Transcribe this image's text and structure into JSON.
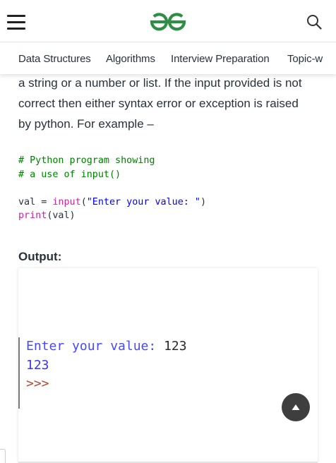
{
  "header": {
    "menu_icon": "hamburger-menu-icon",
    "logo_icon": "geeksforgeeks-logo",
    "search_icon": "search-icon",
    "brand_color": "#2f8d46"
  },
  "nav": {
    "items": [
      "Data Structures",
      "Algorithms",
      "Interview Preparation",
      "Topic-w"
    ]
  },
  "article": {
    "para_lines": [
      "a string or a number or list. If the input provided is not",
      "correct then either syntax error or exception is raised",
      "by python. For example –"
    ],
    "code": {
      "comment1": "# Python program showing",
      "comment2": "# a use of input()",
      "line3_var": "val",
      "line3_eq": " = ",
      "line3_func": "input",
      "line3_open": "(",
      "line3_str": "\"Enter your value: \"",
      "line3_close": ")",
      "line4_func": "print",
      "line4_args": "(val)",
      "colors": {
        "comment": "#008200",
        "keyword": "#c925a0",
        "string": "#0000ff"
      }
    },
    "output_label": "Output:",
    "console": {
      "prompt": "Enter your value:",
      "value": "123",
      "echo": "123",
      "shell_prompt": ">>>"
    }
  },
  "scroll_top_icon": "arrow-up-icon"
}
